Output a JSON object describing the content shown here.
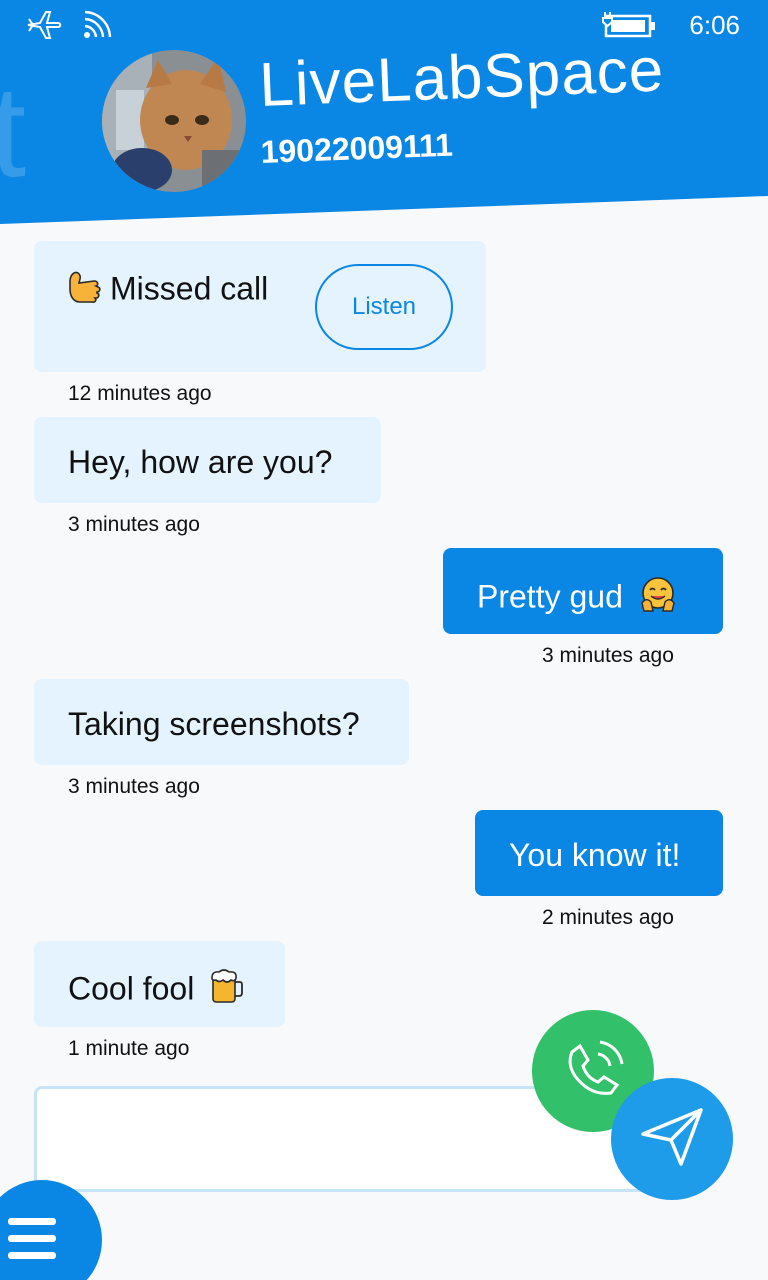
{
  "status_bar": {
    "time": "6:06",
    "icons": [
      "airplane-icon",
      "wifi-icon",
      "battery-charging-icon"
    ]
  },
  "header": {
    "contact_name": "LiveLabSpace",
    "contact_number": "19022009111",
    "ghost_letter": "t"
  },
  "messages": [
    {
      "direction": "incoming",
      "type": "missed_call",
      "text": "Missed call",
      "action_label": "Listen",
      "time": "12 minutes ago"
    },
    {
      "direction": "incoming",
      "text": "Hey, how are you?",
      "time": "3 minutes ago"
    },
    {
      "direction": "outgoing",
      "text": "Pretty gud",
      "emoji": "hugging-face-emoji",
      "time": "3 minutes ago"
    },
    {
      "direction": "incoming",
      "text": "Taking screenshots?",
      "time": "3 minutes ago"
    },
    {
      "direction": "outgoing",
      "text": "You know it!",
      "time": "2 minutes ago"
    },
    {
      "direction": "incoming",
      "text": "Cool fool",
      "emoji": "beer-mug-emoji",
      "time": "1 minute ago"
    }
  ],
  "composer": {
    "value": "",
    "placeholder": ""
  },
  "colors": {
    "accent": "#0a86e4",
    "incoming_bubble": "#e4f3fd",
    "call_button": "#33c06b",
    "send_button": "#1e9be9",
    "background": "#f7f9fb"
  }
}
